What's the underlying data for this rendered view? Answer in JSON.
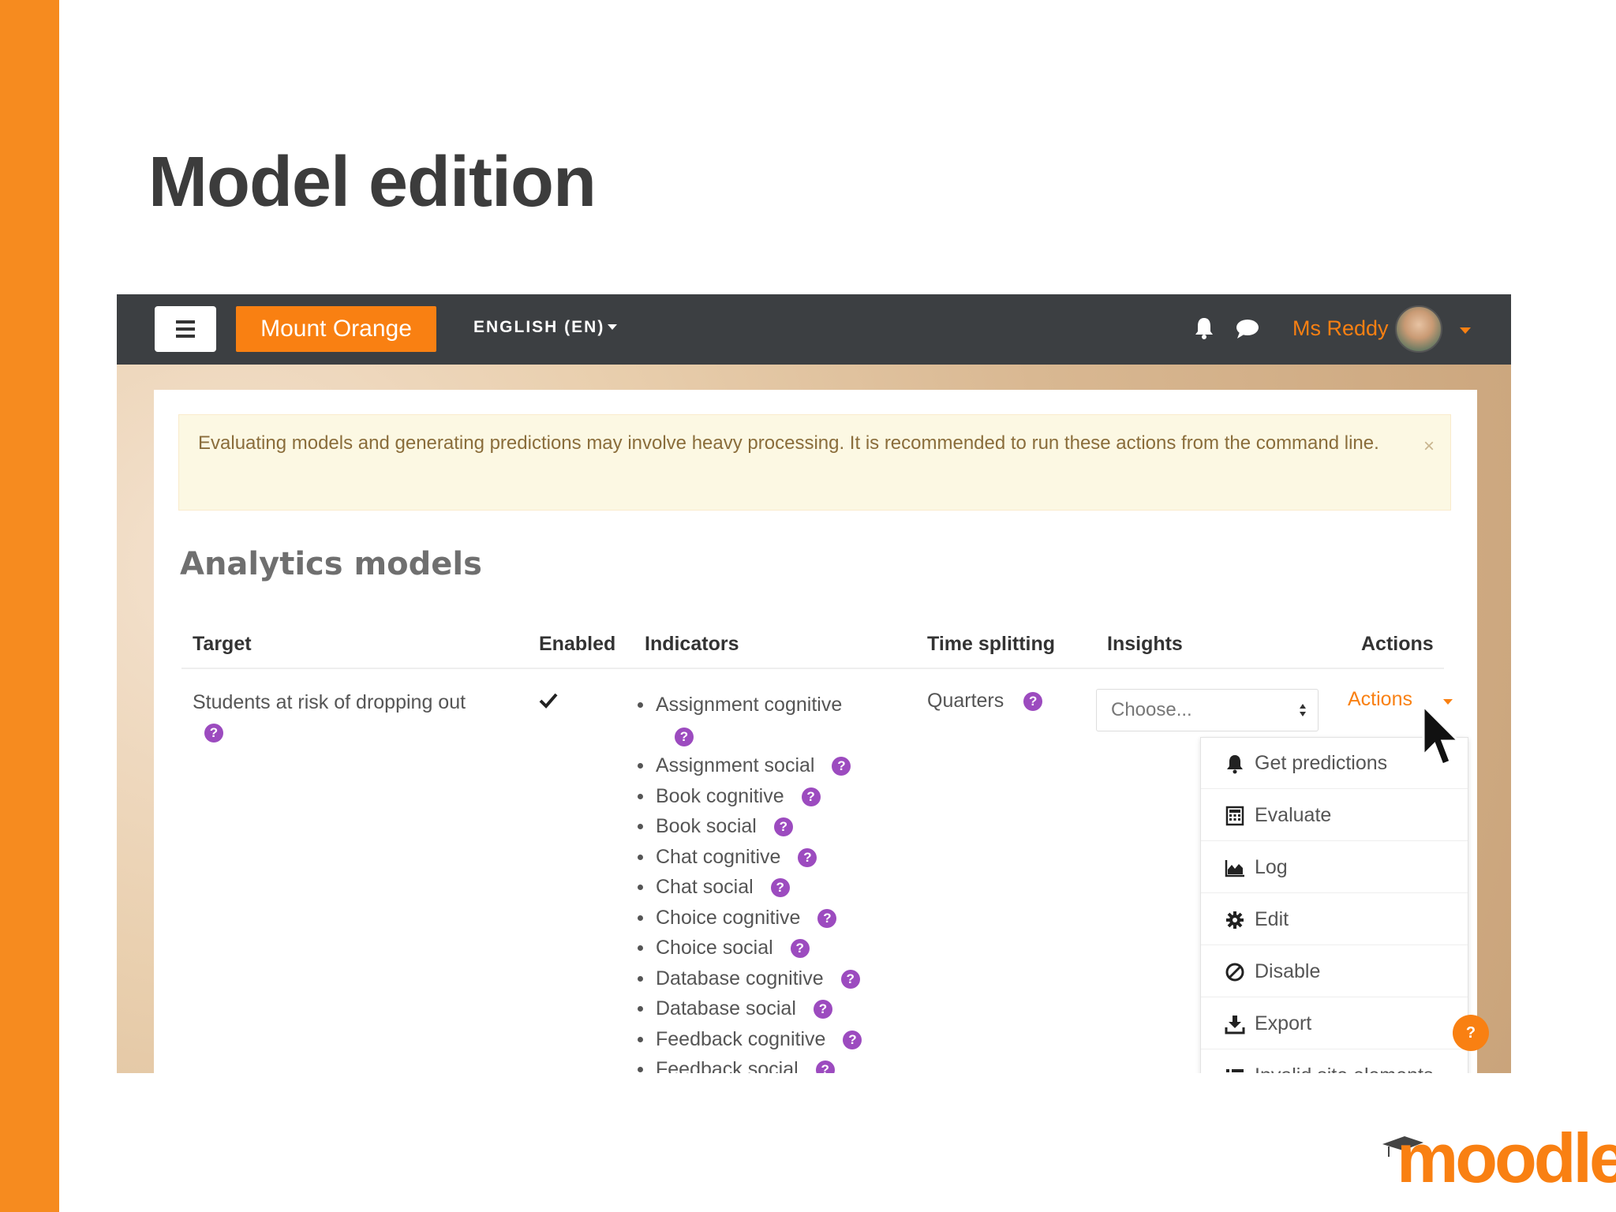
{
  "slide": {
    "title": "Model edition",
    "accent_color": "#f68b1f"
  },
  "navbar": {
    "brand": "Mount Orange",
    "language": "ENGLISH (EN)",
    "user_name": "Ms Reddy",
    "icons": [
      "menu-icon",
      "bell-icon",
      "chat-icon",
      "avatar",
      "chevron-down-icon"
    ]
  },
  "alert": {
    "message": "Evaluating models and generating predictions may involve heavy processing. It is recommended to run these actions from the command line.",
    "close": "×"
  },
  "page": {
    "heading": "Analytics models"
  },
  "table": {
    "headers": {
      "target": "Target",
      "enabled": "Enabled",
      "indicators": "Indicators",
      "time_splitting": "Time splitting",
      "insights": "Insights",
      "actions": "Actions"
    },
    "row": {
      "target": "Students at risk of dropping out",
      "enabled": true,
      "indicators": [
        "Assignment cognitive",
        "Assignment social",
        "Book cognitive",
        "Book social",
        "Chat cognitive",
        "Chat social",
        "Choice cognitive",
        "Choice social",
        "Database cognitive",
        "Database social",
        "Feedback cognitive",
        "Feedback social"
      ],
      "time_splitting": "Quarters",
      "insights_placeholder": "Choose...",
      "actions_label": "Actions"
    }
  },
  "actions_menu": {
    "items": [
      {
        "label": "Get predictions",
        "icon": "bell-icon"
      },
      {
        "label": "Evaluate",
        "icon": "calculator-icon"
      },
      {
        "label": "Log",
        "icon": "area-chart-icon"
      },
      {
        "label": "Edit",
        "icon": "gear-icon"
      },
      {
        "label": "Disable",
        "icon": "ban-icon"
      },
      {
        "label": "Export",
        "icon": "download-icon"
      },
      {
        "label": "Invalid site elements",
        "icon": "list-icon"
      }
    ]
  },
  "help_glyph": "?",
  "footer": {
    "logo_text": "moodle"
  }
}
